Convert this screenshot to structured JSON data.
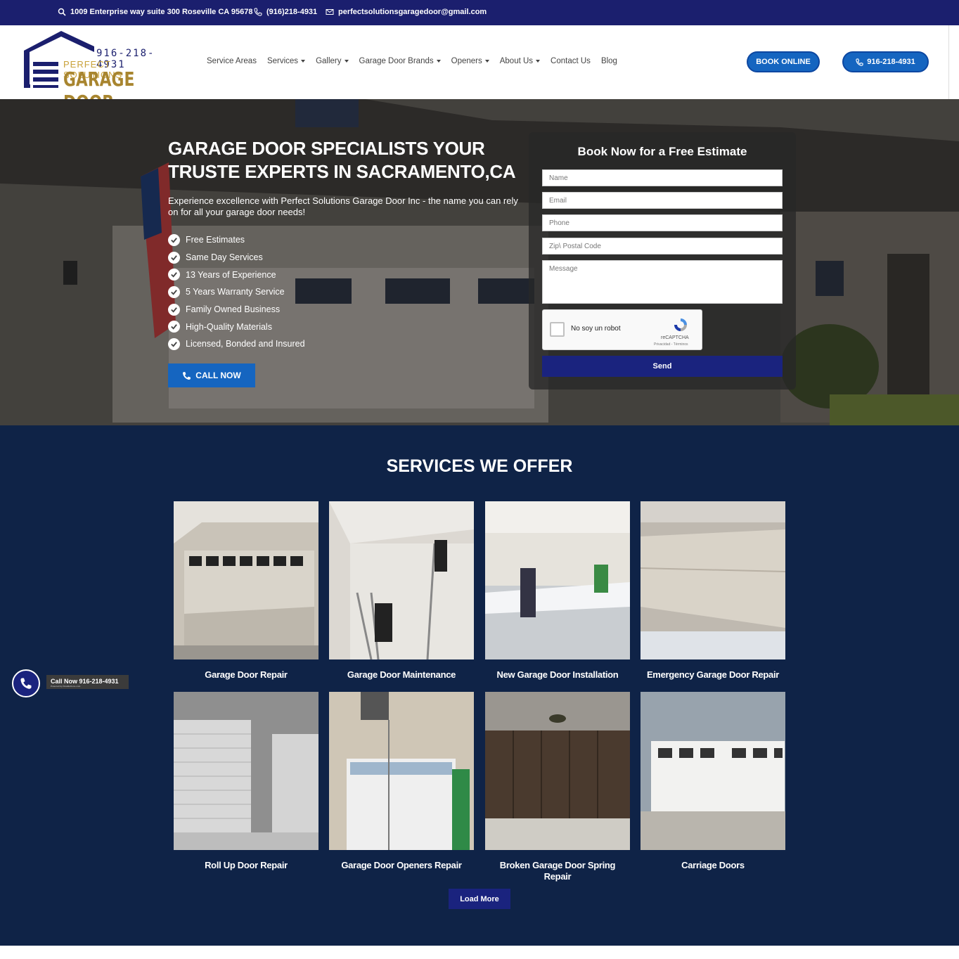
{
  "topbar": {
    "address": "1009 Enterprise way suite 300 Roseville CA 95678",
    "phone": "(916)218-4931",
    "email": "perfectsolutionsgaragedoor@gmail.com"
  },
  "logo": {
    "phone": "916-218-4931",
    "line1": "PERFECT SOLUTIONS",
    "line2": "GARAGE DOOR"
  },
  "nav": {
    "items": [
      {
        "label": "Service Areas",
        "dropdown": false
      },
      {
        "label": "Services",
        "dropdown": true
      },
      {
        "label": "Gallery",
        "dropdown": true
      },
      {
        "label": "Garage Door Brands",
        "dropdown": true
      },
      {
        "label": "Openers",
        "dropdown": true
      },
      {
        "label": "About Us",
        "dropdown": true
      },
      {
        "label": "Contact Us",
        "dropdown": false
      },
      {
        "label": "Blog",
        "dropdown": false
      }
    ],
    "book_online": "BOOK ONLINE",
    "phone_button": "916-218-4931"
  },
  "hero": {
    "title": "GARAGE DOOR SPECIALISTS YOUR TRUSTE EXPERTS IN SACRAMENTO,CA",
    "subtitle": "Experience excellence with Perfect Solutions Garage Door Inc - the name you can rely on for all your garage door needs!",
    "features": [
      "Free Estimates",
      "Same Day Services",
      "13 Years of Experience",
      "5 Years Warranty Service",
      "Family Owned Business",
      "High-Quality Materials",
      "Licensed, Bonded and Insured"
    ],
    "call_now": "CALL NOW"
  },
  "form": {
    "title": "Book Now for a Free Estimate",
    "name_placeholder": "Name",
    "email_placeholder": "Email",
    "phone_placeholder": "Phone",
    "zip_placeholder": "Zip\\ Postal Code",
    "message_placeholder": "Message",
    "captcha_label": "No soy un robot",
    "captcha_brand": "reCAPTCHA",
    "captcha_links": "Privacidad - Términos",
    "send": "Send"
  },
  "services": {
    "title": "SERVICES WE OFFER",
    "items": [
      {
        "label": "Garage Door Repair"
      },
      {
        "label": "Garage Door Maintenance"
      },
      {
        "label": "New Garage Door Installation"
      },
      {
        "label": "Emergency Garage Door Repair"
      },
      {
        "label": "Roll Up Door Repair"
      },
      {
        "label": "Garage Door Openers Repair"
      },
      {
        "label": "Broken Garage Door Spring Repair"
      },
      {
        "label": "Carriage Doors"
      }
    ],
    "load_more": "Load More"
  },
  "floating_call": {
    "label": "Call Now 916-218-4931",
    "powered": "Powered by NowButtons.com"
  },
  "colors": {
    "topbar": "#1b1f6e",
    "accent": "#1565c0",
    "services_bg": "#0f2347",
    "logo_gold": "#a8852f"
  }
}
